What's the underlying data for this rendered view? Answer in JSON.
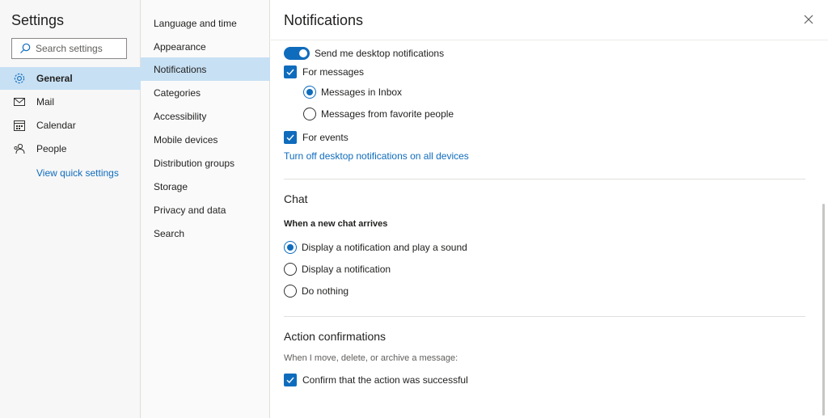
{
  "settings": {
    "title": "Settings",
    "search_placeholder": "Search settings",
    "nav": [
      {
        "label": "General",
        "icon": "gear-icon"
      },
      {
        "label": "Mail",
        "icon": "mail-icon"
      },
      {
        "label": "Calendar",
        "icon": "calendar-icon"
      },
      {
        "label": "People",
        "icon": "people-icon"
      }
    ],
    "quick_link": "View quick settings"
  },
  "categories": [
    "Language and time",
    "Appearance",
    "Notifications",
    "Categories",
    "Accessibility",
    "Mobile devices",
    "Distribution groups",
    "Storage",
    "Privacy and data",
    "Search"
  ],
  "notifications": {
    "title": "Notifications",
    "desktop_toggle_label": "Send me desktop notifications",
    "for_messages_label": "For messages",
    "messages_inbox_label": "Messages in Inbox",
    "messages_favorite_label": "Messages from favorite people",
    "for_events_label": "For events",
    "turn_off_link": "Turn off desktop notifications on all devices"
  },
  "chat": {
    "title": "Chat",
    "subtitle": "When a new chat arrives",
    "options": [
      "Display a notification and play a sound",
      "Display a notification",
      "Do nothing"
    ]
  },
  "action_confirmations": {
    "title": "Action confirmations",
    "description": "When I move, delete, or archive a message:",
    "confirm_label": "Confirm that the action was successful"
  },
  "colors": {
    "accent": "#0f6cbd",
    "selected_bg": "#c7e0f4"
  }
}
